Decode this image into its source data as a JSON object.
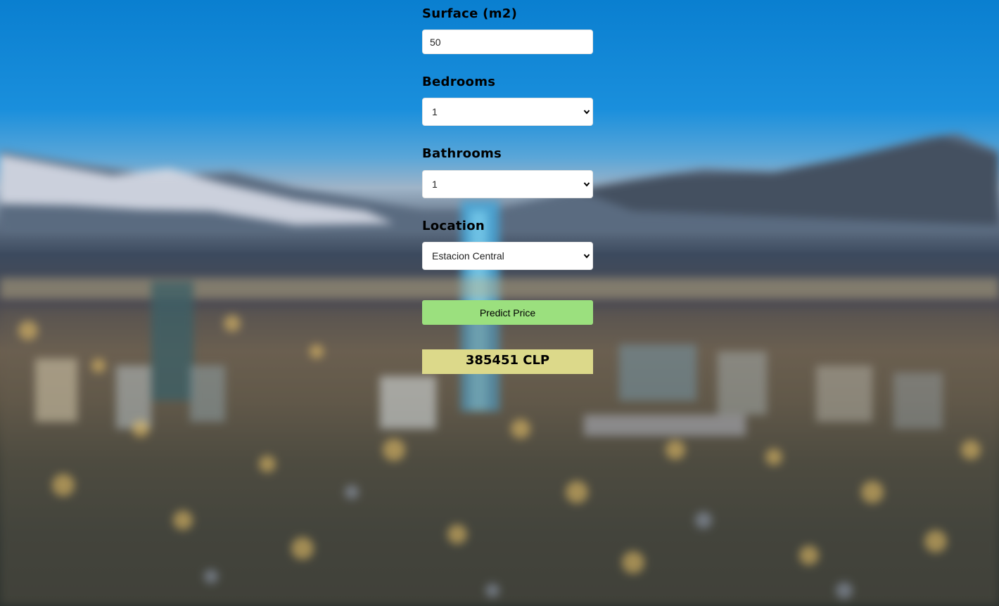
{
  "form": {
    "surface": {
      "label": "Surface (m2)",
      "value": "50"
    },
    "bedrooms": {
      "label": "Bedrooms",
      "selected": "1"
    },
    "bathrooms": {
      "label": "Bathrooms",
      "selected": "1"
    },
    "location": {
      "label": "Location",
      "selected": "Estacion Central"
    },
    "predict_button": "Predict Price",
    "result": "385451 CLP"
  },
  "colors": {
    "button_bg": "#9be07e",
    "result_bg": "#dcd98a"
  }
}
